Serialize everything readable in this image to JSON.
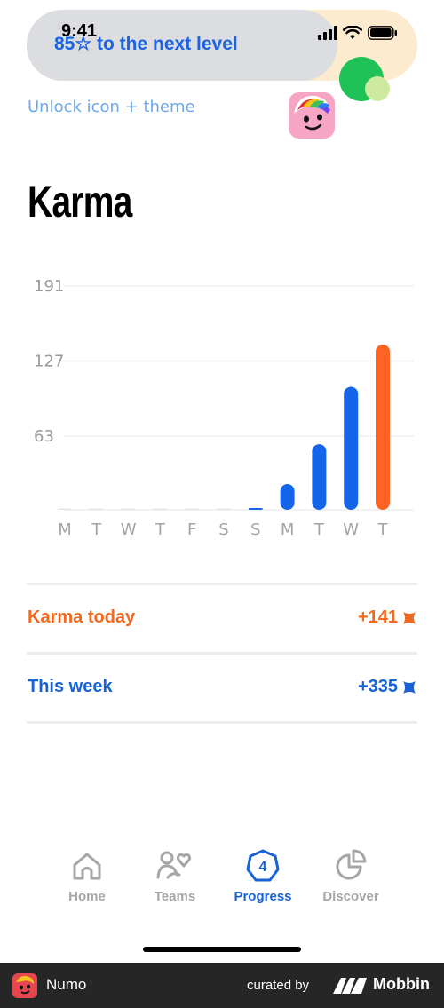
{
  "status_bar": {
    "time": "9:41"
  },
  "banner": {
    "title": "85☆ to the next level",
    "subtitle": "Unlock icon + theme"
  },
  "page": {
    "title": "Karma"
  },
  "chart_data": {
    "type": "bar",
    "categories": [
      "M",
      "T",
      "W",
      "T",
      "F",
      "S",
      "S",
      "M",
      "T",
      "W",
      "T"
    ],
    "values": [
      0,
      0,
      0,
      0,
      0,
      0,
      1,
      22,
      56,
      105,
      141
    ],
    "highlight_index": 10,
    "ylim": [
      0,
      191
    ],
    "yticks": [
      "191",
      "127",
      "63"
    ],
    "grid": true,
    "colors": {
      "default": "#1565e8",
      "highlight": "#fb6422",
      "empty": "#e2e4e8"
    }
  },
  "summary": {
    "today": {
      "label": "Karma today",
      "value": "+141",
      "color": "#f26a21"
    },
    "week": {
      "label": "This week",
      "value": "+335",
      "color": "#1762d6"
    }
  },
  "nav": {
    "items": [
      {
        "label": "Home",
        "icon": "home-icon",
        "active": false
      },
      {
        "label": "Teams",
        "icon": "teams-icon",
        "active": false
      },
      {
        "label": "Progress",
        "icon": "progress-icon",
        "badge": "4",
        "active": true
      },
      {
        "label": "Discover",
        "icon": "discover-icon",
        "active": false
      }
    ],
    "active_color": "#1762d6",
    "inactive_color": "#a6a6a6"
  },
  "footer": {
    "app_name": "Numo",
    "curated_by": "curated by",
    "brand": "Mobbin"
  }
}
